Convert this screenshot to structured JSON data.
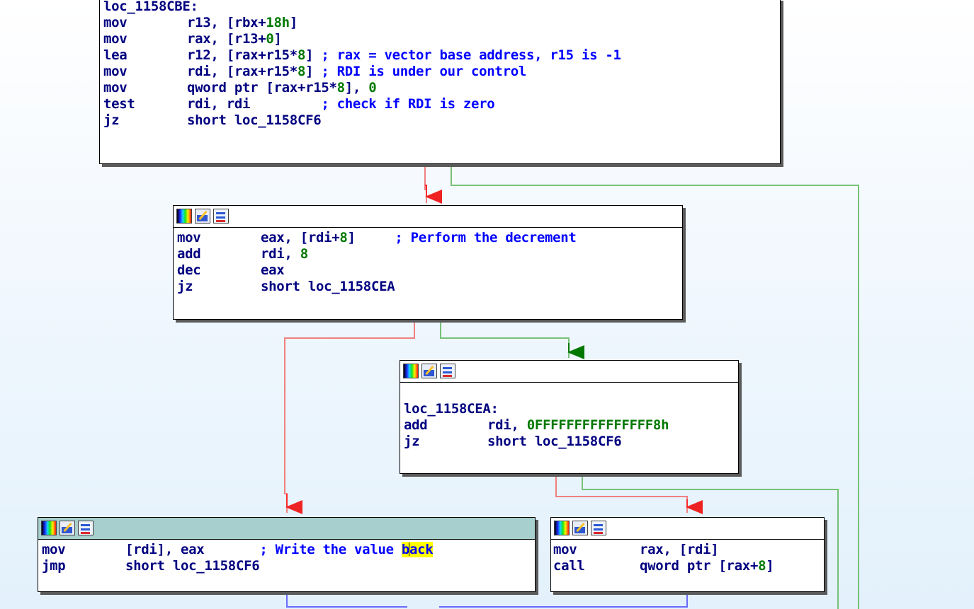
{
  "nodes": {
    "top": {
      "lines": [
        {
          "label": "loc_1158CBE:"
        },
        {
          "mn": "mov",
          "parts": [
            {
              "t": "r13, [rbx+"
            },
            {
              "t": "18h",
              "c": "num"
            },
            {
              "t": "]"
            }
          ]
        },
        {
          "mn": "mov",
          "parts": [
            {
              "t": "rax, [r13+"
            },
            {
              "t": "0",
              "c": "num"
            },
            {
              "t": "]"
            }
          ]
        },
        {
          "mn": "lea",
          "parts": [
            {
              "t": "r12, [rax+r15*"
            },
            {
              "t": "8",
              "c": "num"
            },
            {
              "t": "] "
            },
            {
              "t": "; rax = vector base address, r15 is -1",
              "c": "cm"
            }
          ]
        },
        {
          "mn": "mov",
          "parts": [
            {
              "t": "rdi, [rax+r15*"
            },
            {
              "t": "8",
              "c": "num"
            },
            {
              "t": "] "
            },
            {
              "t": "; RDI is under our control",
              "c": "cm"
            }
          ]
        },
        {
          "mn": "mov",
          "parts": [
            {
              "t": "qword ptr [rax+r15*"
            },
            {
              "t": "8",
              "c": "num"
            },
            {
              "t": "], "
            },
            {
              "t": "0",
              "c": "num"
            }
          ]
        },
        {
          "mn": "test",
          "parts": [
            {
              "t": "rdi, rdi         "
            },
            {
              "t": "; check if RDI is zero",
              "c": "cm"
            }
          ]
        },
        {
          "mn": "jz",
          "parts": [
            {
              "t": "short loc_1158CF6"
            }
          ]
        }
      ]
    },
    "decrement": {
      "lines": [
        {
          "mn": "mov",
          "parts": [
            {
              "t": "eax, [rdi+"
            },
            {
              "t": "8",
              "c": "num"
            },
            {
              "t": "]     "
            },
            {
              "t": "; Perform the decrement",
              "c": "cm"
            }
          ]
        },
        {
          "mn": "add",
          "parts": [
            {
              "t": "rdi, "
            },
            {
              "t": "8",
              "c": "num"
            }
          ]
        },
        {
          "mn": "dec",
          "parts": [
            {
              "t": "eax"
            }
          ]
        },
        {
          "mn": "jz",
          "parts": [
            {
              "t": "short loc_1158CEA"
            }
          ]
        }
      ]
    },
    "cea": {
      "lines": [
        {
          "blank": true
        },
        {
          "label": "loc_1158CEA:"
        },
        {
          "mn": "add",
          "parts": [
            {
              "t": "rdi, "
            },
            {
              "t": "0FFFFFFFFFFFFFFF8h",
              "c": "num"
            }
          ]
        },
        {
          "mn": "jz",
          "parts": [
            {
              "t": "short loc_1158CF6"
            }
          ]
        }
      ]
    },
    "write": {
      "lines": [
        {
          "mn": "mov",
          "parts": [
            {
              "t": "[rdi], eax       "
            },
            {
              "t": "; Write the value ",
              "c": "cm"
            },
            {
              "t": "b",
              "c": "cm hl"
            },
            {
              "caret": true
            },
            {
              "t": "ack",
              "c": "cm hl"
            }
          ]
        },
        {
          "mn": "jmp",
          "parts": [
            {
              "t": "short loc_1158CF6"
            }
          ]
        }
      ]
    },
    "call": {
      "lines": [
        {
          "mn": "mov",
          "parts": [
            {
              "t": "rax, [rdi]"
            }
          ]
        },
        {
          "mn": "call",
          "parts": [
            {
              "t": "qword ptr [rax+"
            },
            {
              "t": "8",
              "c": "num"
            },
            {
              "t": "]"
            }
          ]
        }
      ]
    }
  },
  "colors": {
    "true_edge": "#007800",
    "false_edge": "#ff3333",
    "jump_edge": "#2020ff"
  }
}
